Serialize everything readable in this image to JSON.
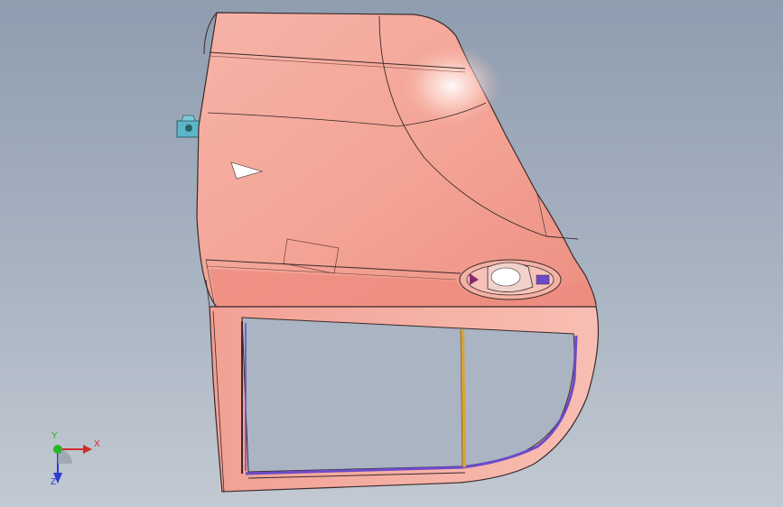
{
  "colors": {
    "viewport_top": "#8f9db0",
    "viewport_bottom": "#c2c9d2",
    "body_panel": "#f2a89c",
    "body_edge": "#3a2a2a",
    "glass_seal": "#6b4bc8",
    "pillar": "#d8a236",
    "hinge": "#5cb6c8",
    "axis_x": "#d22b2b",
    "axis_y": "#2bb52b",
    "axis_z": "#2b3bd2"
  },
  "icons": {
    "triad": "coordinate-triad-icon",
    "hinge": "hinge-bracket-icon",
    "handle": "door-handle-icon"
  },
  "triad": {
    "x_label": "X",
    "y_label": "Y",
    "z_label": "Z"
  }
}
